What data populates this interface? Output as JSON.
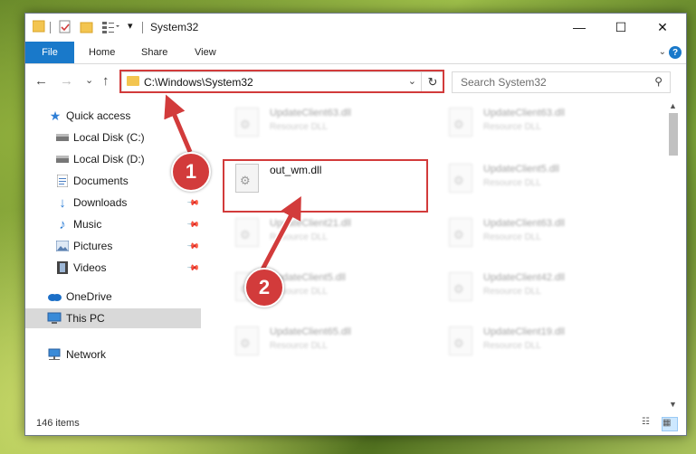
{
  "window": {
    "title": "System32",
    "minimize_glyph": "—",
    "maximize_glyph": "☐",
    "close_glyph": "✕"
  },
  "ribbon": {
    "file_tab": "File",
    "tabs": [
      "Home",
      "Share",
      "View"
    ],
    "help_glyph": "?"
  },
  "navigation": {
    "back_glyph": "←",
    "forward_glyph": "→",
    "recent_glyph": "⌄",
    "up_glyph": "↑",
    "address": "C:\\Windows\\System32",
    "search_placeholder": "Search System32"
  },
  "sidebar": {
    "items": [
      {
        "label": "Quick access",
        "icon": "star-icon",
        "pinned": false
      },
      {
        "label": "Local Disk (C:)",
        "icon": "drive-icon",
        "pinned": false
      },
      {
        "label": "Local Disk (D:)",
        "icon": "drive-icon",
        "pinned": false
      },
      {
        "label": "Documents",
        "icon": "documents-icon",
        "pinned": true
      },
      {
        "label": "Downloads",
        "icon": "download-icon",
        "pinned": true
      },
      {
        "label": "Music",
        "icon": "music-icon",
        "pinned": true
      },
      {
        "label": "Pictures",
        "icon": "pictures-icon",
        "pinned": true
      },
      {
        "label": "Videos",
        "icon": "videos-icon",
        "pinned": true
      },
      {
        "label": "OneDrive",
        "icon": "cloud-icon",
        "pinned": false
      },
      {
        "label": "This PC",
        "icon": "computer-icon",
        "pinned": false,
        "selected": true
      },
      {
        "label": "Network",
        "icon": "network-icon",
        "pinned": false
      }
    ]
  },
  "files": [
    {
      "name": "UpdateClient63.dll",
      "type": "Resource DLL",
      "faded": true
    },
    {
      "name": "UpdateClient63.dll",
      "type": "Resource DLL",
      "faded": true
    },
    {
      "name": "out_wm.dll",
      "type": "",
      "faded": false,
      "highlighted": true
    },
    {
      "name": "UpdateClient5.dll",
      "type": "Resource DLL",
      "faded": true
    },
    {
      "name": "UpdateClient21.dll",
      "type": "Resource DLL",
      "faded": true
    },
    {
      "name": "UpdateClient63.dll",
      "type": "Resource DLL",
      "faded": true
    },
    {
      "name": "UpdateClient5.dll",
      "type": "Resource DLL",
      "faded": true
    },
    {
      "name": "UpdateClient42.dll",
      "type": "Resource DLL",
      "faded": true
    },
    {
      "name": "UpdateClient65.dll",
      "type": "Resource DLL",
      "faded": true
    },
    {
      "name": "UpdateClient19.dll",
      "type": "Resource DLL",
      "faded": true
    }
  ],
  "status": {
    "item_count": "146 items"
  },
  "annotations": {
    "step1": "1",
    "step2": "2",
    "color": "#d23b3b"
  }
}
